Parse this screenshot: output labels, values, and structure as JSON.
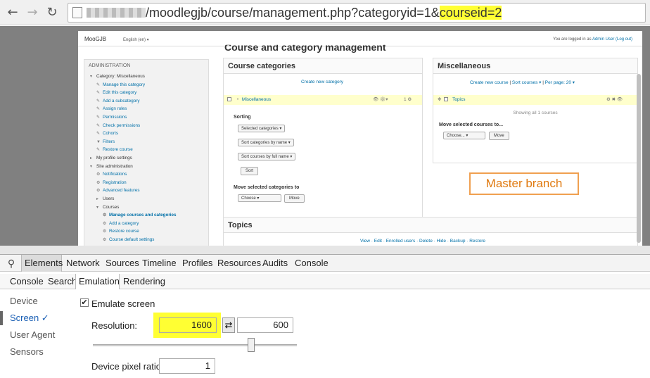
{
  "browser": {
    "url_prefix": "/moodlegjb/course/management.php?categoryid=1&",
    "url_highlight": "courseid=2"
  },
  "moodle": {
    "site_name": "MooGJB",
    "language": "English (en) ▾",
    "login_prefix": "You are logged in as ",
    "login_user": "Admin User",
    "logout": "(Log out)",
    "page_heading": "Course and category management",
    "admin": {
      "title": "ADMINISTRATION",
      "tree": [
        {
          "glyph": "▾",
          "text": "Category: Miscellaneous",
          "style": "plain",
          "indent": 0
        },
        {
          "glyph": "✎",
          "text": "Manage this category",
          "style": "link",
          "indent": 1
        },
        {
          "glyph": "✎",
          "text": "Edit this category",
          "style": "link",
          "indent": 1
        },
        {
          "glyph": "✎",
          "text": "Add a subcategory",
          "style": "link",
          "indent": 1
        },
        {
          "glyph": "✎",
          "text": "Assign roles",
          "style": "link",
          "indent": 1
        },
        {
          "glyph": "✎",
          "text": "Permissions",
          "style": "link",
          "indent": 1
        },
        {
          "glyph": "✎",
          "text": "Check permissions",
          "style": "link",
          "indent": 1
        },
        {
          "glyph": "✎",
          "text": "Cohorts",
          "style": "link",
          "indent": 1
        },
        {
          "glyph": "▼",
          "text": "Filters",
          "style": "link",
          "indent": 1
        },
        {
          "glyph": "✎",
          "text": "Restore course",
          "style": "link",
          "indent": 1
        },
        {
          "glyph": "▸",
          "text": "My profile settings",
          "style": "plain",
          "indent": 0
        },
        {
          "glyph": "▾",
          "text": "Site administration",
          "style": "plain",
          "indent": 0
        },
        {
          "glyph": "⚙",
          "text": "Notifications",
          "style": "link",
          "indent": 1
        },
        {
          "glyph": "⚙",
          "text": "Registration",
          "style": "link",
          "indent": 1
        },
        {
          "glyph": "⚙",
          "text": "Advanced features",
          "style": "link",
          "indent": 1
        },
        {
          "glyph": "▸",
          "text": "Users",
          "style": "plain",
          "indent": 1
        },
        {
          "glyph": "▾",
          "text": "Courses",
          "style": "plain",
          "indent": 1
        },
        {
          "glyph": "⚙",
          "text": "Manage courses and categories",
          "style": "active",
          "indent": 2
        },
        {
          "glyph": "⚙",
          "text": "Add a category",
          "style": "link",
          "indent": 2
        },
        {
          "glyph": "⚙",
          "text": "Restore course",
          "style": "link",
          "indent": 2
        },
        {
          "glyph": "⚙",
          "text": "Course default settings",
          "style": "link",
          "indent": 2
        }
      ]
    },
    "categories": {
      "title": "Course categories",
      "create": "Create new category",
      "row_name": "Miscellaneous",
      "row_icons": "👁 ⚙▾",
      "row_count": "1 ⚙",
      "sorting_label": "Sorting",
      "select1": "Selected categories ▾",
      "select2": "Sort categories by name ▾",
      "select3": "Sort courses by full name ▾",
      "sort_btn": "Sort",
      "move_label": "Move selected categories to",
      "move_select": "Choose ▾",
      "move_btn": "Move"
    },
    "misc": {
      "title": "Miscellaneous",
      "create_course": "Create new course",
      "sort_courses": "Sort courses ▾",
      "per_page": "Per page: 20 ▾",
      "sep": "|",
      "course_name": "Topics",
      "course_icons": "⚙ ✖ 👁",
      "showing": "Showing all 1 courses",
      "move_label": "Move selected courses to...",
      "move_select": "Choose... ▾",
      "move_btn": "Move"
    },
    "topics": {
      "title": "Topics",
      "links": "View · Edit · Enrolled users · Delete · Hide · Backup · Restore"
    },
    "annotation": "Master branch"
  },
  "devtools": {
    "tabs": [
      "Elements",
      "Network",
      "Sources",
      "Timeline",
      "Profiles",
      "Resources",
      "Audits",
      "Console"
    ],
    "selected_tab": "Elements",
    "subtabs": [
      "Console",
      "Search",
      "Emulation",
      "Rendering"
    ],
    "selected_subtab": "Emulation",
    "side": [
      "Device",
      "Screen ✓",
      "User Agent",
      "Sensors"
    ],
    "selected_side": "Screen ✓",
    "emulate_label": "Emulate screen",
    "resolution_label": "Resolution:",
    "width": "1600",
    "height": "600",
    "swap": "⇄",
    "dpr_label": "Device pixel ratio:",
    "dpr": "1",
    "highlight_color": "#ffff33"
  }
}
